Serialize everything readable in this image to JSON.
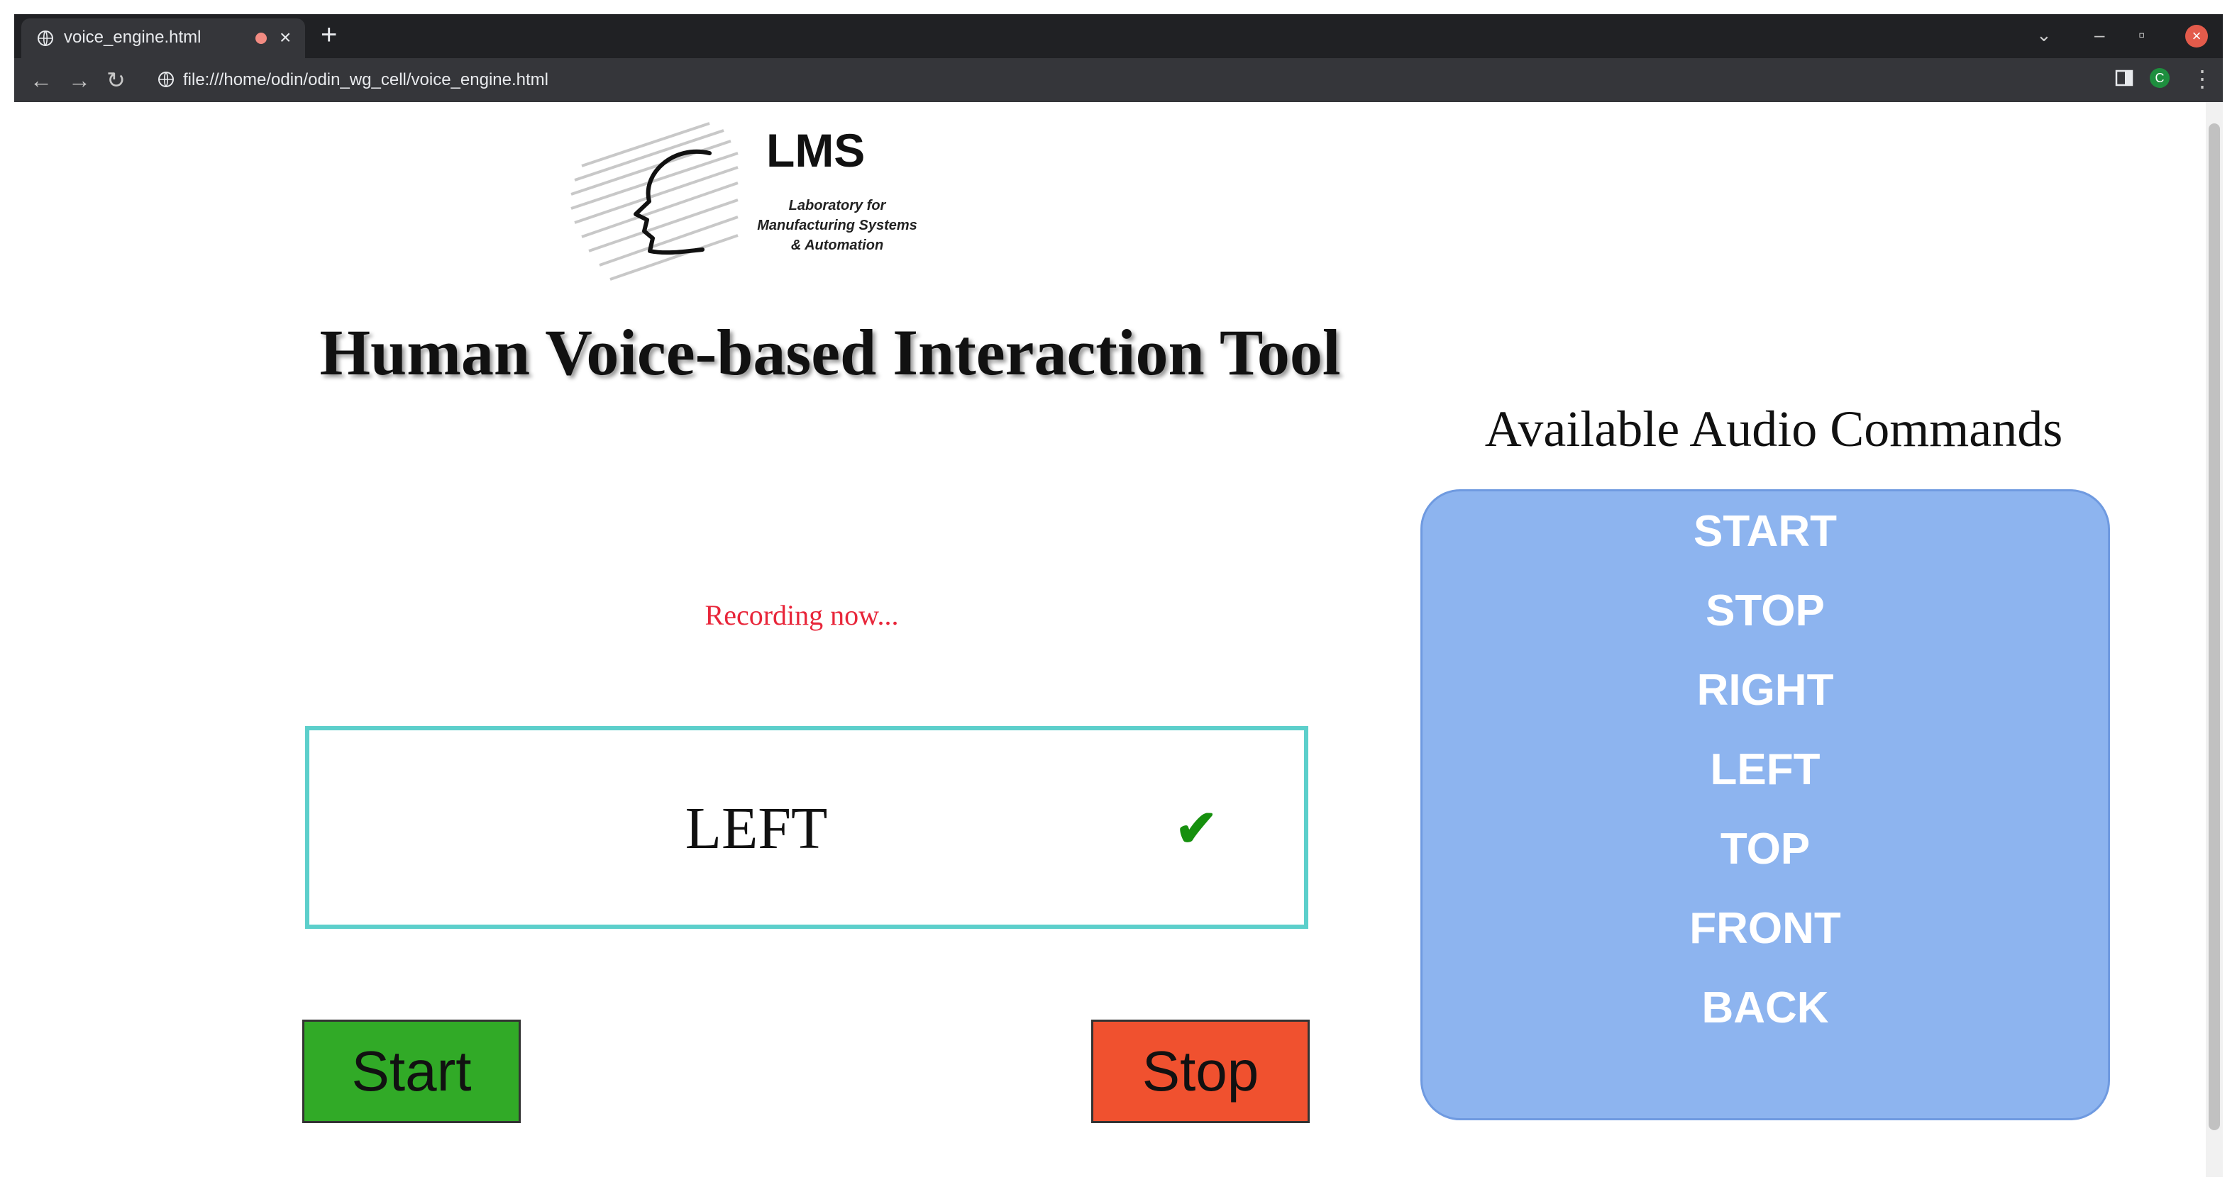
{
  "browser": {
    "tab_title": "voice_engine.html",
    "tab_close": "×",
    "new_tab": "+",
    "url": "file:///home/odin/odin_wg_cell/voice_engine.html",
    "window_controls": {
      "dropdown": "⌄",
      "minimize": "–",
      "maximize": "▫",
      "close": "×"
    },
    "nav": {
      "back": "←",
      "forward": "→",
      "reload": "↻"
    },
    "extension_letter": "C",
    "menu": "⋮"
  },
  "logo": {
    "name": "LMS",
    "subtitle_lines": [
      "Laboratory for",
      "Manufacturing Systems",
      "& Automation"
    ]
  },
  "page": {
    "title": "Human Voice-based Interaction Tool",
    "status": "Recording now...",
    "recognized_command": "LEFT",
    "check": "✔",
    "start_label": "Start",
    "stop_label": "Stop"
  },
  "commands": {
    "title": "Available Audio Commands",
    "items": [
      "START",
      "STOP",
      "RIGHT",
      "LEFT",
      "TOP",
      "FRONT",
      "BACK"
    ]
  },
  "colors": {
    "start_button": "#31aa27",
    "stop_button": "#f0512f",
    "status_text": "#e8263a",
    "result_border": "#5ccfcb",
    "commands_panel": "#8db4ef",
    "check_mark": "#16900e"
  }
}
